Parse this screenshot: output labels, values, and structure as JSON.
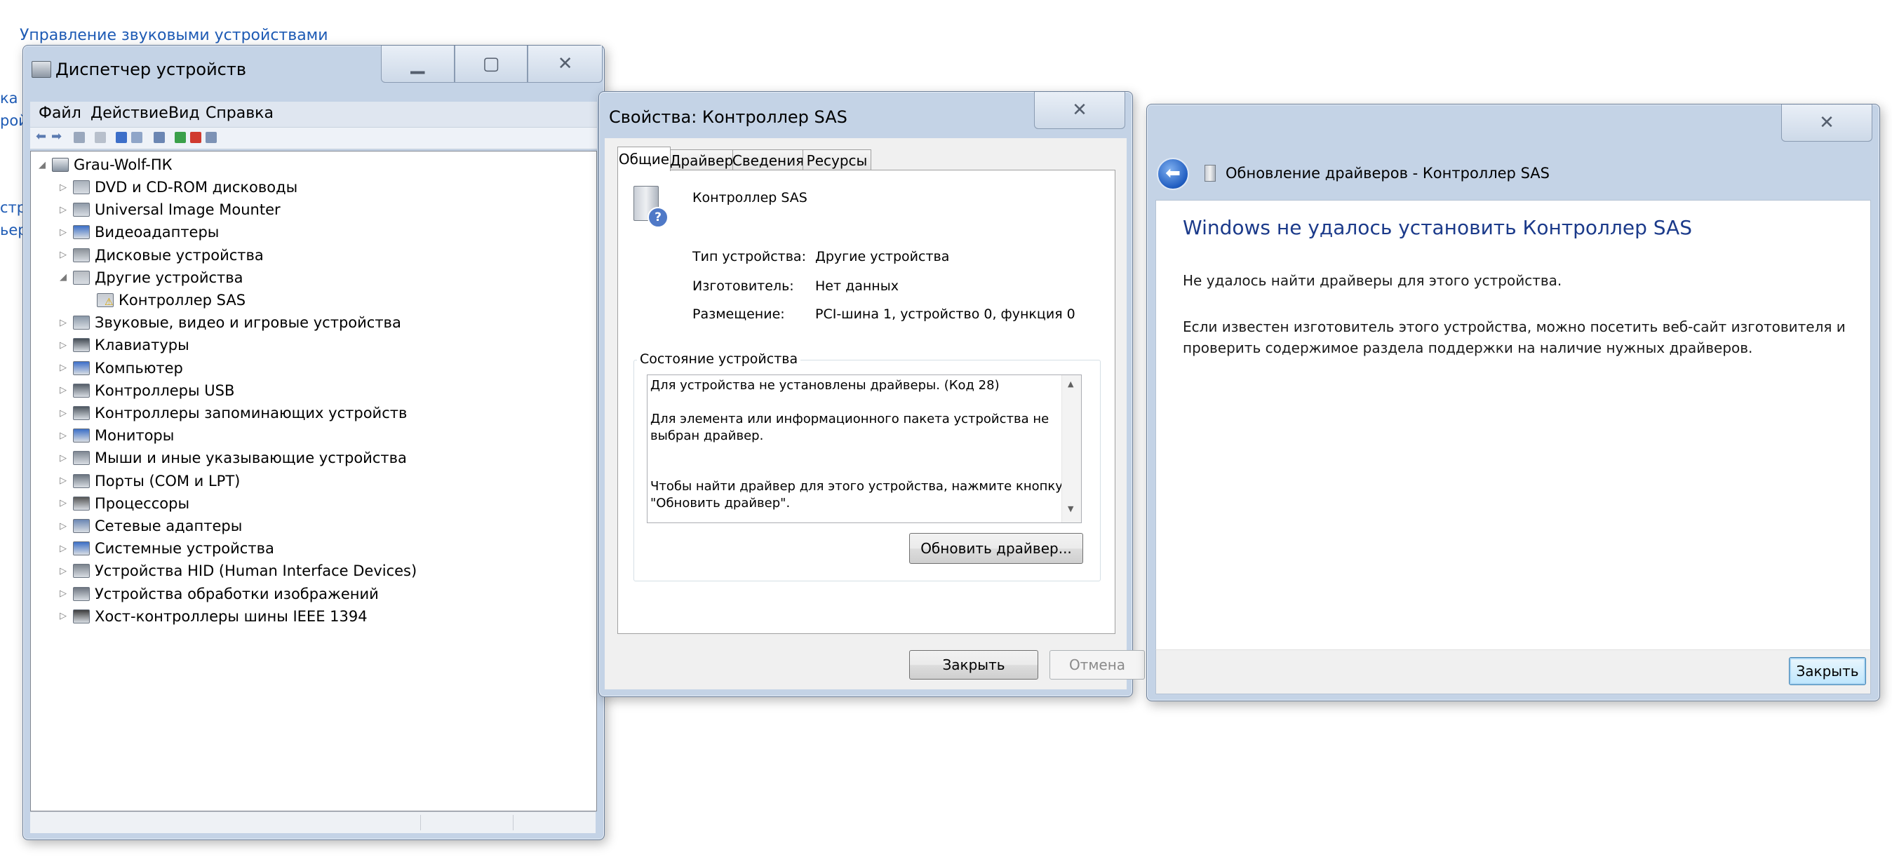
{
  "background": {
    "link_sound": "Управление звуковыми устройствами",
    "fragments": [
      "ка ф",
      "рой",
      "стро",
      "ьер"
    ]
  },
  "device_manager": {
    "title": "Диспетчер устройств",
    "menu": [
      "Файл",
      "Действие",
      "Вид",
      "Справка"
    ],
    "root": "Grau-Wolf-ПК",
    "items": [
      {
        "label": "DVD и CD-ROM дисководы",
        "icon": "dvd-drive-icon",
        "expanded": false
      },
      {
        "label": "Universal Image Mounter",
        "icon": "image-mounter-icon",
        "expanded": false
      },
      {
        "label": "Видеоадаптеры",
        "icon": "display-adapter-icon",
        "expanded": false
      },
      {
        "label": "Дисковые устройства",
        "icon": "disk-drive-icon",
        "expanded": false
      },
      {
        "label": "Другие устройства",
        "icon": "other-devices-icon",
        "expanded": true
      },
      {
        "label": "Контроллер SAS",
        "icon": "unknown-device-warning-icon",
        "child": true
      },
      {
        "label": "Звуковые, видео и игровые устройства",
        "icon": "sound-icon",
        "expanded": false
      },
      {
        "label": "Клавиатуры",
        "icon": "keyboard-icon",
        "expanded": false
      },
      {
        "label": "Компьютер",
        "icon": "computer-icon",
        "expanded": false
      },
      {
        "label": "Контроллеры USB",
        "icon": "usb-icon",
        "expanded": false
      },
      {
        "label": "Контроллеры запоминающих устройств",
        "icon": "storage-controller-icon",
        "expanded": false
      },
      {
        "label": "Мониторы",
        "icon": "monitor-icon",
        "expanded": false
      },
      {
        "label": "Мыши и иные указывающие устройства",
        "icon": "mouse-icon",
        "expanded": false
      },
      {
        "label": "Порты (COM и LPT)",
        "icon": "port-icon",
        "expanded": false
      },
      {
        "label": "Процессоры",
        "icon": "processor-icon",
        "expanded": false
      },
      {
        "label": "Сетевые адаптеры",
        "icon": "network-adapter-icon",
        "expanded": false
      },
      {
        "label": "Системные устройства",
        "icon": "system-devices-icon",
        "expanded": false
      },
      {
        "label": "Устройства HID (Human Interface Devices)",
        "icon": "hid-icon",
        "expanded": false
      },
      {
        "label": "Устройства обработки изображений",
        "icon": "imaging-icon",
        "expanded": false
      },
      {
        "label": "Хост-контроллеры шины IEEE 1394",
        "icon": "ieee1394-icon",
        "expanded": false
      }
    ]
  },
  "properties": {
    "title": "Свойства: Контроллер SAS",
    "tabs": [
      "Общие",
      "Драйвер",
      "Сведения",
      "Ресурсы"
    ],
    "active_tab": "Общие",
    "device_name": "Контроллер SAS",
    "fields": [
      {
        "label": "Тип устройства:",
        "value": "Другие устройства"
      },
      {
        "label": "Изготовитель:",
        "value": "Нет данных"
      },
      {
        "label": "Размещение:",
        "value": "PCI-шина 1, устройство 0, функция 0"
      }
    ],
    "status_group": "Состояние устройства",
    "status_lines": [
      "Для устройства не установлены драйверы. (Код 28)",
      "Для элемента или информационного пакета устройства не",
      "выбран драйвер.",
      "Чтобы найти драйвер для этого устройства, нажмите кнопку",
      "\"Обновить драйвер\"."
    ],
    "update_button": "Обновить драйвер...",
    "close_button": "Закрыть",
    "cancel_button": "Отмена"
  },
  "wizard": {
    "title": "Обновление драйверов - Контроллер SAS",
    "heading": "Windows не удалось установить Контроллер SAS",
    "line1": "Не удалось найти драйверы для этого устройства.",
    "line2": "Если известен изготовитель этого устройства, можно посетить веб-сайт изготовителя и",
    "line3": "проверить содержимое раздела поддержки на наличие нужных драйверов.",
    "close_button": "Закрыть"
  },
  "colors": {
    "link": "#1e5bb5",
    "wizard_heading": "#1b3a8a",
    "frame": "#c4d3e6"
  }
}
